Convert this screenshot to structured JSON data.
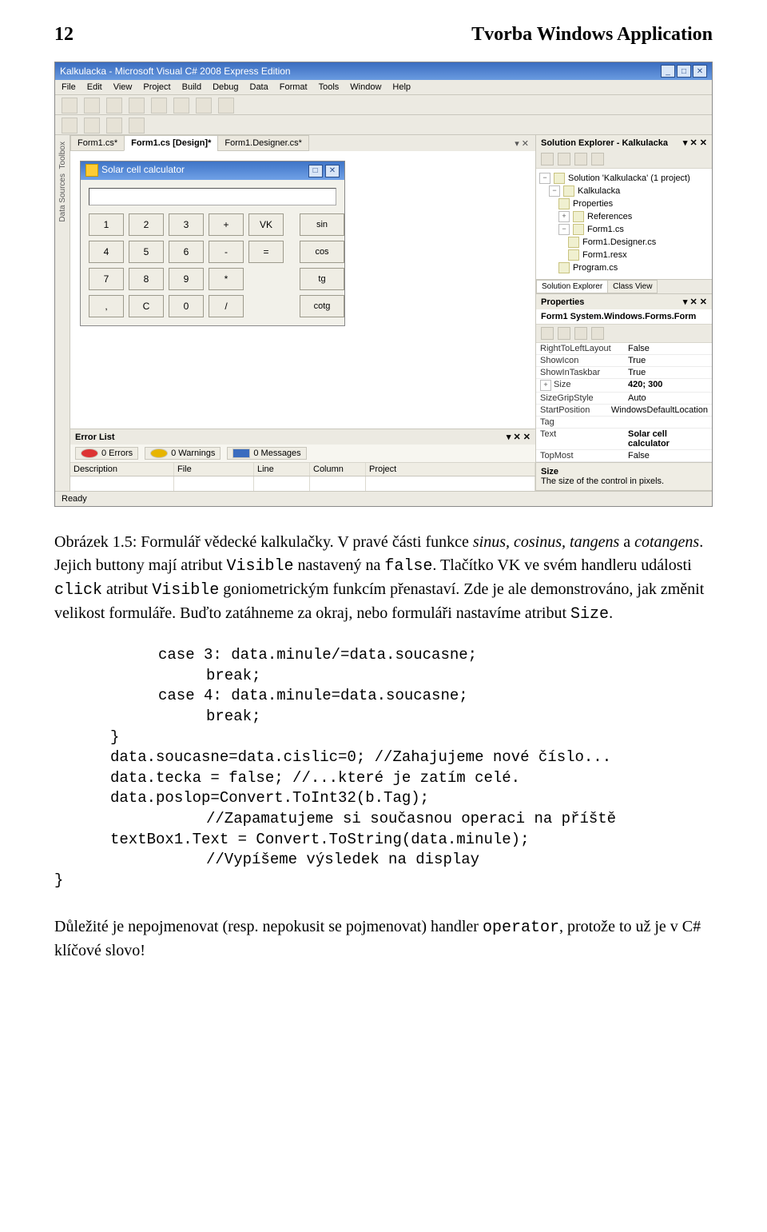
{
  "page": {
    "number": "12",
    "title": "Tvorba Windows Application"
  },
  "ide": {
    "title": "Kalkulacka - Microsoft Visual C# 2008 Express Edition",
    "menu": [
      "File",
      "Edit",
      "View",
      "Project",
      "Build",
      "Debug",
      "Data",
      "Format",
      "Tools",
      "Window",
      "Help"
    ],
    "vtabs": [
      "Toolbox",
      "Data Sources"
    ],
    "doc_tabs": [
      "Form1.cs*",
      "Form1.cs [Design]*",
      "Form1.Designer.cs*"
    ],
    "doc_tabs_active": 1,
    "tabs_close": "▾  ✕",
    "calc": {
      "title": "Solar cell calculator",
      "controls": [
        "□",
        "✕"
      ],
      "rows": [
        [
          "1",
          "2",
          "3",
          "+",
          "VK",
          "sin"
        ],
        [
          "4",
          "5",
          "6",
          "-",
          "=",
          "cos"
        ],
        [
          "7",
          "8",
          "9",
          "*",
          "",
          "tg"
        ],
        [
          ",",
          "C",
          "0",
          "/",
          "",
          "cotg"
        ]
      ]
    },
    "errorlist": {
      "title": "Error List",
      "close": "▾ ✕ ✕",
      "filters": [
        "0 Errors",
        "0 Warnings",
        "0 Messages"
      ],
      "cols": [
        "Description",
        "File",
        "Line",
        "Column",
        "Project"
      ]
    },
    "statusbar": "Ready",
    "right": {
      "se_title": "Solution Explorer - Kalkulacka",
      "se_close": "▾ ✕ ✕",
      "tree": [
        {
          "lvl": 0,
          "exp": "−",
          "txt": "Solution 'Kalkulacka' (1 project)"
        },
        {
          "lvl": 1,
          "exp": "−",
          "txt": "Kalkulacka"
        },
        {
          "lvl": 2,
          "exp": "",
          "txt": "Properties"
        },
        {
          "lvl": 2,
          "exp": "+",
          "txt": "References"
        },
        {
          "lvl": 2,
          "exp": "−",
          "txt": "Form1.cs"
        },
        {
          "lvl": 3,
          "exp": "",
          "txt": "Form1.Designer.cs"
        },
        {
          "lvl": 3,
          "exp": "",
          "txt": "Form1.resx"
        },
        {
          "lvl": 2,
          "exp": "",
          "txt": "Program.cs"
        }
      ],
      "se_tabs": [
        "Solution Explorer",
        "Class View"
      ],
      "props_title": "Properties",
      "props_close": "▾ ✕ ✕",
      "props_head": "Form1  System.Windows.Forms.Form",
      "props": [
        {
          "n": "RightToLeftLayout",
          "v": "False"
        },
        {
          "n": "ShowIcon",
          "v": "True"
        },
        {
          "n": "ShowInTaskbar",
          "v": "True"
        },
        {
          "n": "Size",
          "v": "420; 300",
          "bold": true,
          "exp": "+"
        },
        {
          "n": "SizeGripStyle",
          "v": "Auto"
        },
        {
          "n": "StartPosition",
          "v": "WindowsDefaultLocation"
        },
        {
          "n": "Tag",
          "v": ""
        },
        {
          "n": "Text",
          "v": "Solar cell calculator",
          "bold": true
        },
        {
          "n": "TopMost",
          "v": "False"
        }
      ],
      "props_foot_name": "Size",
      "props_foot_desc": "The size of the control in pixels."
    }
  },
  "caption": {
    "a": "Obrázek 1.5: Formulář vědecké kalkulačky. V pravé části funkce ",
    "b": "sinus, cosinus, tangens",
    "c": " a ",
    "d": "cotangens",
    "e": ". Jejich buttony mají atribut ",
    "visible": "Visible",
    "f": " nastavený na ",
    "false": "false",
    "g": ". Tlačítko VK ve svém handleru události ",
    "click": "click",
    "h": " atribut ",
    "i": " goniometrickým funkcím přenastaví. Zde je ale demonstrováno, jak změnit velikost formuláře. Buďto zatáhneme za okraj, nebo formuláři nastavíme atribut ",
    "size": "Size",
    "j": "."
  },
  "code": {
    "l1": "case 3: data.minule/=data.soucasne;",
    "l2": "break;",
    "l3": "case 4: data.minule=data.soucasne;",
    "l4": "break;",
    "l5": "}",
    "l6": "data.soucasne=data.cislic=0; //Zahajujeme nové číslo...",
    "l7": "data.tecka = false; //...které je zatím celé.",
    "l8": "data.poslop=Convert.ToInt32(b.Tag);",
    "l9": "//Zapamatujeme si současnou operaci na příště",
    "l10": "textBox1.Text = Convert.ToString(data.minule);",
    "l11": "//Vypíšeme výsledek na display",
    "l12": "}"
  },
  "bottom": {
    "a": "Důležité je nepojmenovat (resp. nepokusit se pojmenovat) handler ",
    "op": "operator",
    "b": ", protože to už je v C# klíčové slovo!"
  }
}
